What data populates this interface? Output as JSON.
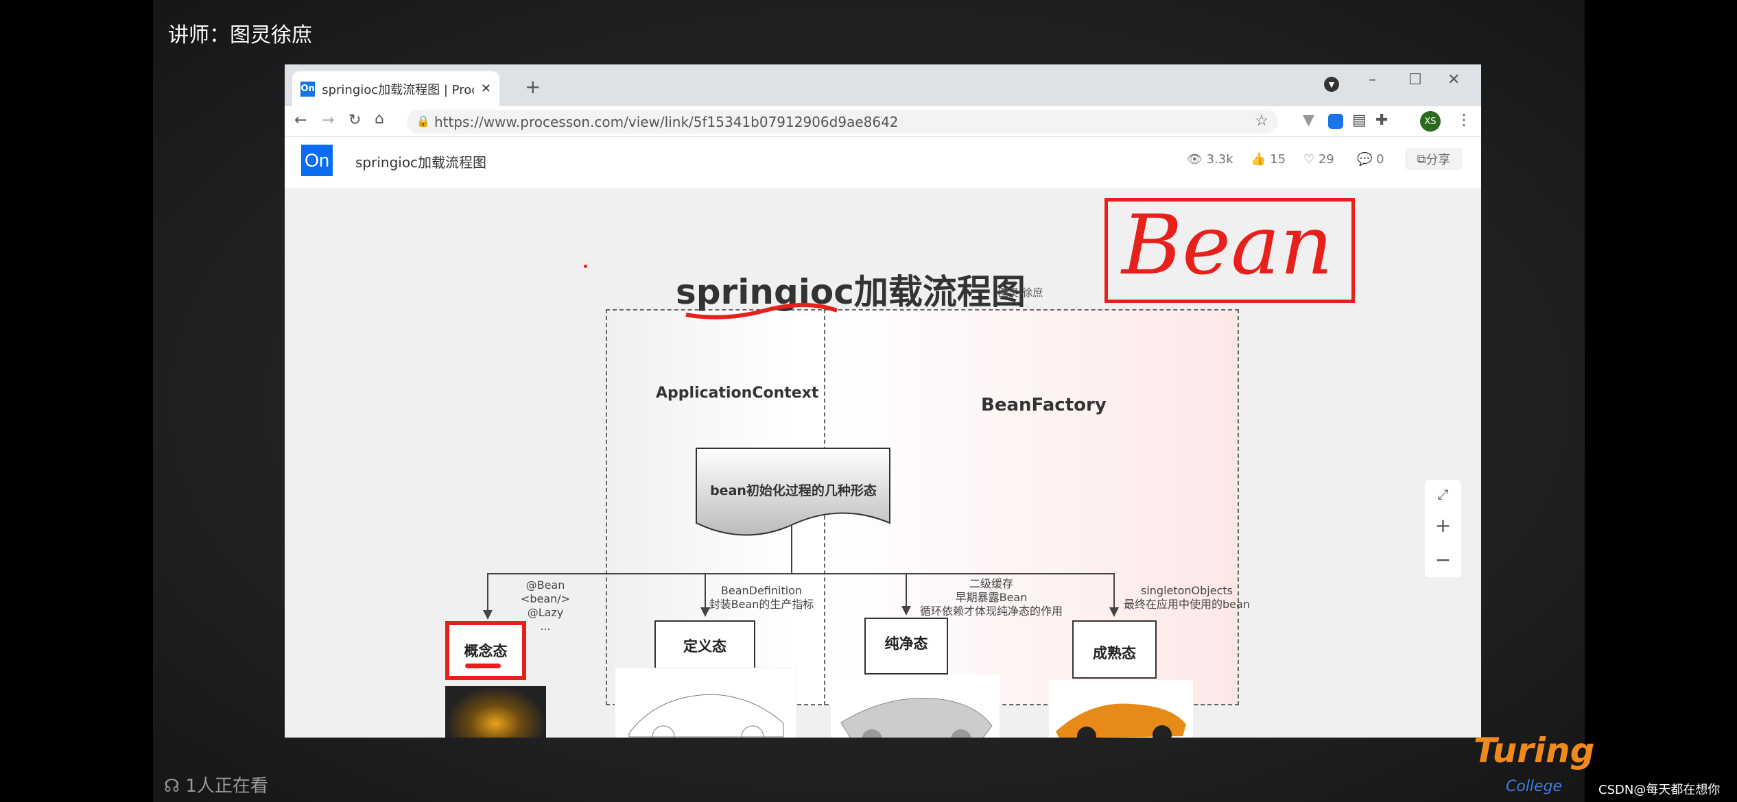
{
  "overlay": {
    "lecturer": "讲师：图灵徐庶",
    "viewers": "1人正在看",
    "brand": "Turing",
    "brand_sub": "College",
    "credit": "CSDN@每天都在想你"
  },
  "browser": {
    "tab_title": "springioc加载流程图 | ProcessOn",
    "favicon": "On",
    "url": "https://www.processon.com/view/link/5f15341b07912906d9ae8642",
    "avatar": "XS"
  },
  "page": {
    "logo": "On",
    "title": "springioc加载流程图",
    "views": "3.3k",
    "likes": "15",
    "favorites": "29",
    "comments": "0",
    "share": "分享"
  },
  "diagram": {
    "title": "springioc加载流程图",
    "subtitle": "图灵-徐庶",
    "handwritten": "Bean",
    "app_context": "ApplicationContext",
    "bean_factory": "BeanFactory",
    "root": "bean初始化过程的几种形态",
    "states": [
      {
        "label": "概念态",
        "note": [
          "@Bean",
          "<bean/>",
          "@Lazy",
          "..."
        ]
      },
      {
        "label": "定义态",
        "note": [
          "BeanDefinition",
          "封装Bean的生产指标"
        ]
      },
      {
        "label": "纯净态",
        "note": [
          "二级缓存",
          "早期暴露Bean",
          "循环依赖才体现纯净态的作用"
        ]
      },
      {
        "label": "成熟态",
        "note": [
          "singletonObjects",
          "最终在应用中使用的bean"
        ]
      }
    ]
  },
  "colors": {
    "accent": "#0a6cf0",
    "annotation": "#e8201c"
  }
}
